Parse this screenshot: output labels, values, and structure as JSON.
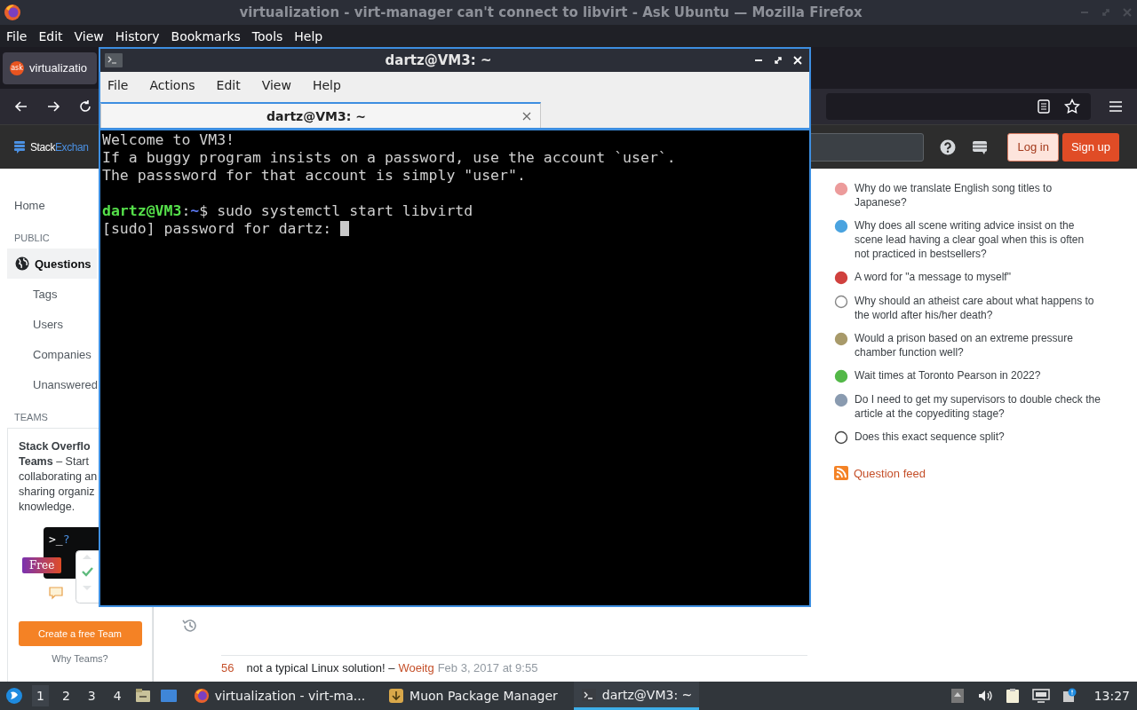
{
  "firefox": {
    "title": "virtualization - virt-manager can't connect to libvirt - Ask Ubuntu — Mozilla Firefox",
    "menu": [
      "File",
      "Edit",
      "View",
      "History",
      "Bookmarks",
      "Tools",
      "Help"
    ],
    "tab": {
      "icon_text": "ask",
      "label": "virtualizatio"
    }
  },
  "site_header": {
    "logo": {
      "first": "Stack",
      "second": "Exchan"
    },
    "buttons": [
      {
        "label": "Log in",
        "kind": "secondary"
      },
      {
        "label": "Sign up",
        "kind": "primary"
      }
    ]
  },
  "left_nav": [
    {
      "label": "Home",
      "kind": "top",
      "selected": false
    },
    {
      "label": "PUBLIC",
      "kind": "heading"
    },
    {
      "label": "Questions",
      "kind": "top",
      "selected": true
    },
    {
      "label": "Tags",
      "kind": "sub",
      "selected": false
    },
    {
      "label": "Users",
      "kind": "sub",
      "selected": false
    },
    {
      "label": "Companies",
      "kind": "sub",
      "selected": false
    },
    {
      "label": "Unanswered",
      "kind": "sub",
      "selected": false
    },
    {
      "label": "TEAMS",
      "kind": "heading"
    }
  ],
  "teams": {
    "lines": [
      "**Stack Overflo**",
      "**Teams** – Start",
      "collaborating an",
      "sharing organiz",
      "knowledge."
    ],
    "prompt": ">_",
    "prompt_mark": "?",
    "badge": "Free",
    "button": "Create a free Team",
    "link": "Why Teams?"
  },
  "comment": {
    "score": "56",
    "text": "not a typical Linux solution! –",
    "author": "Woeitg",
    "date": "Feb 3, 2017 at 9:55"
  },
  "hot_questions": [
    {
      "title": "Why do we translate English song titles to Japanese?"
    },
    {
      "title": "Why does all scene writing advice insist on the scene lead having a clear goal when this is often not practiced in bestsellers?"
    },
    {
      "title": "A word for \"a message to myself\""
    },
    {
      "title": "Why should an atheist care about what happens to the world after his/her death?"
    },
    {
      "title": "Would a prison based on an extreme pressure chamber function well?"
    },
    {
      "title": "Wait times at Toronto Pearson in 2022?"
    },
    {
      "title": "Do I need to get my supervisors to double check the article at the copyediting stage?"
    },
    {
      "title": "Does this exact sequence split?"
    }
  ],
  "question_feed": "Question feed",
  "terminal": {
    "title": "dartz@VM3: ~",
    "menu": [
      "File",
      "Actions",
      "Edit",
      "View",
      "Help"
    ],
    "tab": "dartz@VM3: ~",
    "lines": [
      {
        "kind": "text",
        "text": "Welcome to VM3!"
      },
      {
        "kind": "text",
        "text": "If a buggy program insists on a password, use the account `user`."
      },
      {
        "kind": "text",
        "text": "The passsword for that account is simply \"user\"."
      },
      {
        "kind": "blank"
      },
      {
        "kind": "prompt",
        "user": "dartz@VM3",
        "sep": ":",
        "path": "~",
        "command": "$ sudo systemctl start libvirtd"
      },
      {
        "kind": "input",
        "text": "[sudo] password for dartz: ",
        "cursor": true
      }
    ]
  },
  "taskbar": {
    "workspaces": [
      {
        "label": "1",
        "selected": true
      },
      {
        "label": "2",
        "selected": false
      },
      {
        "label": "3",
        "selected": false
      },
      {
        "label": "4",
        "selected": false
      }
    ],
    "tasks": [
      {
        "kind": "browser",
        "label": "virtualization - virt-ma...",
        "selected": false
      },
      {
        "kind": "package",
        "label": "Muon Package Manager",
        "selected": false
      },
      {
        "kind": "terminal",
        "label": "dartz@VM3: ~",
        "selected": true
      }
    ],
    "clock": "13:27"
  }
}
